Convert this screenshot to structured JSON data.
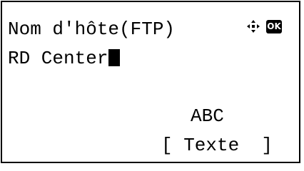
{
  "screen": {
    "title": "Nom d'hôte(FTP)",
    "value": "RD Center",
    "input_mode": "ABC",
    "softkey_label": "[ Texte  ]"
  },
  "icons": {
    "navigation": "four-way-arrow-icon",
    "ok": "OK"
  }
}
